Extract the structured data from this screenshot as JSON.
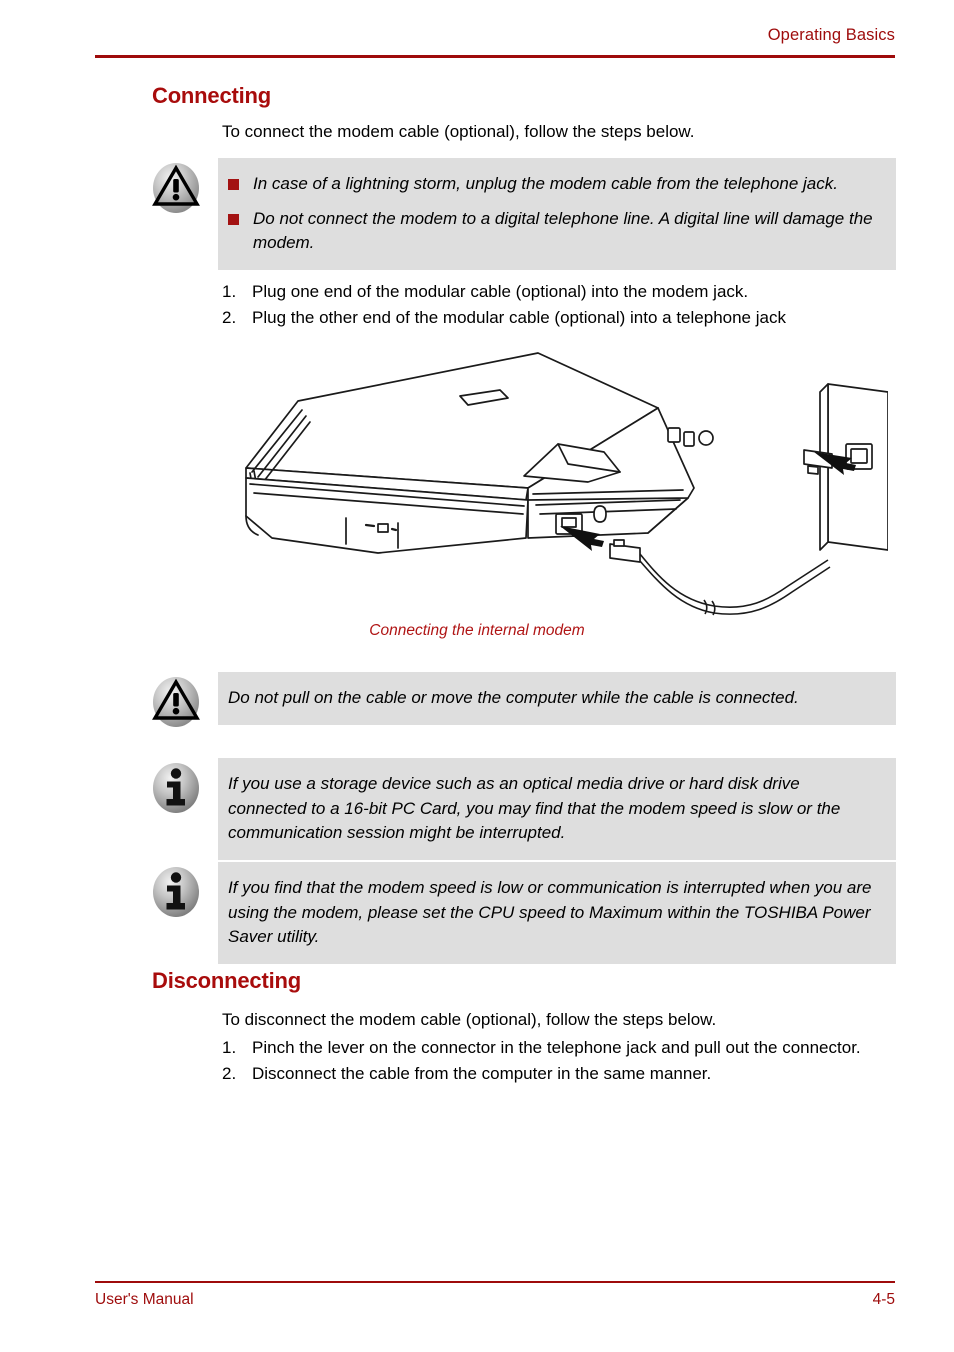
{
  "header": {
    "title": "Operating Basics"
  },
  "footer": {
    "left": "User's Manual",
    "page": "4-5"
  },
  "colors": {
    "heading_red": "#a80c0c",
    "rule_red": "#9e0b0b",
    "caption_red": "#b01515",
    "note_background": "#dedede",
    "bullet_square": "#a31212"
  },
  "sections": {
    "connecting": {
      "heading": "Connecting",
      "intro": "To connect the modem cable (optional), follow the steps below.",
      "warning_bullets": [
        "In case of a lightning storm, unplug the modem cable from the telephone jack.",
        "Do not connect the modem to a digital telephone line. A digital line will damage the modem."
      ],
      "steps": [
        {
          "num": "1.",
          "text": "Plug one end of the modular cable (optional) into the modem jack."
        },
        {
          "num": "2.",
          "text": "Plug the other end of the modular cable (optional) into a telephone jack"
        }
      ]
    },
    "figure": {
      "caption": "Connecting the internal modem",
      "icon_name": "laptop-modem-connection-illustration"
    },
    "notes": [
      {
        "icon": "warning-triangle-icon",
        "text": "Do not pull on the cable or move the computer while the cable is connected."
      },
      {
        "icon": "info-circle-icon",
        "text": "If you use a storage device such as an optical media drive or hard disk drive connected to a 16-bit PC Card, you may find that the modem speed is slow or the communication session might be interrupted."
      },
      {
        "icon": "info-circle-icon",
        "text": "If you find that the modem speed is low or communication is interrupted when you are using the modem, please set the CPU speed to Maximum within the TOSHIBA Power Saver utility."
      }
    ],
    "disconnecting": {
      "heading": "Disconnecting",
      "intro": "To disconnect the modem cable (optional), follow the steps below.",
      "steps": [
        {
          "num": "1.",
          "text": "Pinch the lever on the connector in the telephone jack and pull out the connector."
        },
        {
          "num": "2.",
          "text": "Disconnect the cable from the computer in the same manner."
        }
      ]
    }
  }
}
